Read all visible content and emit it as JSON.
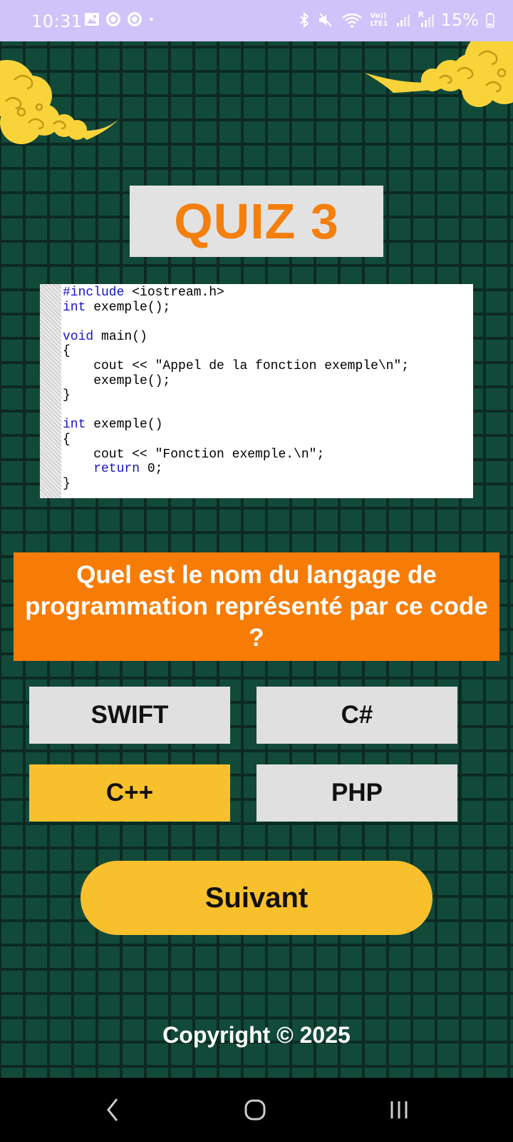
{
  "status_bar": {
    "time": "10:31",
    "battery_text": "15%",
    "left_icons": [
      "gallery-icon",
      "whatsapp-icon",
      "whatsapp-icon",
      "dot-icon"
    ],
    "right_icons": [
      "bluetooth-icon",
      "mute-icon",
      "wifi-icon",
      "volte-icon",
      "signal-icon",
      "signal-r-icon",
      "battery-icon"
    ],
    "volte_label": "Vo))",
    "lte_label": "LTE1",
    "r_label": "R",
    "text_color": "#ffffff",
    "background": "#cfc3f9"
  },
  "quiz": {
    "title": "QUIZ 3",
    "title_color": "#f47f0c",
    "code_lines": [
      {
        "kw": "#include",
        "rest": " <iostream.h>"
      },
      {
        "kw": "int",
        "rest": " exemple();"
      },
      {
        "kw": "",
        "rest": ""
      },
      {
        "kw": "void",
        "rest": " main()"
      },
      {
        "kw": "",
        "rest": "{"
      },
      {
        "kw": "",
        "rest": "    cout << \"Appel de la fonction exemple\\n\";"
      },
      {
        "kw": "",
        "rest": "    exemple();"
      },
      {
        "kw": "",
        "rest": "}"
      },
      {
        "kw": "",
        "rest": ""
      },
      {
        "kw": "int",
        "rest": " exemple()"
      },
      {
        "kw": "",
        "rest": "{"
      },
      {
        "kw": "",
        "rest": "    cout << \"Fonction exemple.\\n\";"
      },
      {
        "kw": "    return",
        "rest": " 0;"
      },
      {
        "kw": "",
        "rest": "}"
      }
    ],
    "question": "Quel est le nom du langage de programmation représenté par ce code ?",
    "question_bg": "#f67c05",
    "answers": [
      {
        "label": "SWIFT",
        "selected": false
      },
      {
        "label": "C#",
        "selected": false
      },
      {
        "label": "C++",
        "selected": true
      },
      {
        "label": "PHP",
        "selected": false
      }
    ],
    "selected_color": "#f8c02c",
    "next_label": "Suivant",
    "copyright": "Copyright © 2025"
  },
  "colors": {
    "background": "#124a3a",
    "grid_lines": "#0c2a22",
    "cloud": "#f8d33a"
  },
  "nav_bar": {
    "buttons": [
      "back-icon",
      "home-icon",
      "recents-icon"
    ]
  }
}
